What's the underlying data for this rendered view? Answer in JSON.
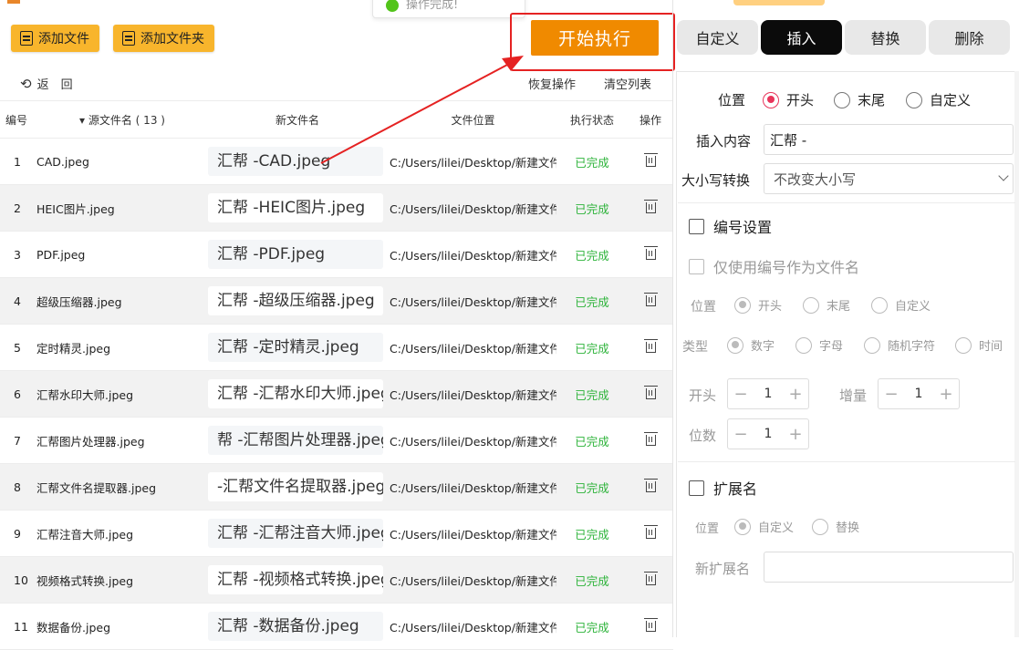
{
  "toolbar": {
    "add_file": "添加文件",
    "add_folder": "添加文件夹",
    "start": "开始执行",
    "back": "返　回",
    "restore": "恢复操作",
    "clear": "清空列表"
  },
  "toast": {
    "text": "操作完成!"
  },
  "table": {
    "headers": {
      "no": "编号",
      "src": "▾ 源文件名 ( 13 )",
      "new": "新文件名",
      "loc": "文件位置",
      "status": "执行状态",
      "op": "操作"
    },
    "rows": [
      {
        "no": "1",
        "src": "CAD.jpeg",
        "new": "汇帮 -CAD.jpeg",
        "loc": "C:/Users/lilei/Desktop/新建文件夹",
        "status": "已完成"
      },
      {
        "no": "2",
        "src": "HEIC图片.jpeg",
        "new": "汇帮 -HEIC图片.jpeg",
        "loc": "C:/Users/lilei/Desktop/新建文件夹",
        "status": "已完成"
      },
      {
        "no": "3",
        "src": "PDF.jpeg",
        "new": "汇帮 -PDF.jpeg",
        "loc": "C:/Users/lilei/Desktop/新建文件夹",
        "status": "已完成"
      },
      {
        "no": "4",
        "src": "超级压缩器.jpeg",
        "new": "汇帮 -超级压缩器.jpeg",
        "loc": "C:/Users/lilei/Desktop/新建文件夹",
        "status": "已完成"
      },
      {
        "no": "5",
        "src": "定时精灵.jpeg",
        "new": "汇帮 -定时精灵.jpeg",
        "loc": "C:/Users/lilei/Desktop/新建文件夹",
        "status": "已完成"
      },
      {
        "no": "6",
        "src": "汇帮水印大师.jpeg",
        "new": "汇帮 -汇帮水印大师.jpeg",
        "loc": "C:/Users/lilei/Desktop/新建文件夹",
        "status": "已完成"
      },
      {
        "no": "7",
        "src": "汇帮图片处理器.jpeg",
        "new": "帮 -汇帮图片处理器.jpeg",
        "loc": "C:/Users/lilei/Desktop/新建文件夹",
        "status": "已完成"
      },
      {
        "no": "8",
        "src": "汇帮文件名提取器.jpeg",
        "new": " -汇帮文件名提取器.jpeg",
        "loc": "C:/Users/lilei/Desktop/新建文件夹",
        "status": "已完成"
      },
      {
        "no": "9",
        "src": "汇帮注音大师.jpeg",
        "new": "汇帮 -汇帮注音大师.jpeg",
        "loc": "C:/Users/lilei/Desktop/新建文件夹",
        "status": "已完成"
      },
      {
        "no": "10",
        "src": "视频格式转换.jpeg",
        "new": "汇帮 -视频格式转换.jpeg",
        "loc": "C:/Users/lilei/Desktop/新建文件夹",
        "status": "已完成"
      },
      {
        "no": "11",
        "src": "数据备份.jpeg",
        "new": "汇帮 -数据备份.jpeg",
        "loc": "C:/Users/lilei/Desktop/新建文件夹",
        "status": "已完成"
      }
    ]
  },
  "tabs": [
    "自定义",
    "插入",
    "替换",
    "删除"
  ],
  "panel": {
    "position_label": "位置",
    "position_opts": [
      "开头",
      "末尾",
      "自定义"
    ],
    "insert_label": "插入内容",
    "insert_value": "汇帮 -",
    "case_label": "大小写转换",
    "case_value": "不改变大小写",
    "numbering_label": "编号设置",
    "only_number_label": "仅使用编号作为文件名",
    "num_position_label": "位置",
    "num_position_opts": [
      "开头",
      "末尾",
      "自定义"
    ],
    "type_label": "类型",
    "type_opts": [
      "数字",
      "字母",
      "随机字符",
      "时间"
    ],
    "start_label": "开头",
    "start_value": "1",
    "inc_label": "增量",
    "inc_value": "1",
    "digits_label": "位数",
    "digits_value": "1",
    "ext_label": "扩展名",
    "ext_position_label": "位置",
    "ext_opts": [
      "自定义",
      "替换"
    ],
    "new_ext_label": "新扩展名"
  },
  "colors": {
    "accent": "#f08a00",
    "highlight": "#e52222",
    "done": "#2db33a",
    "radio_on": "#e8345a"
  }
}
